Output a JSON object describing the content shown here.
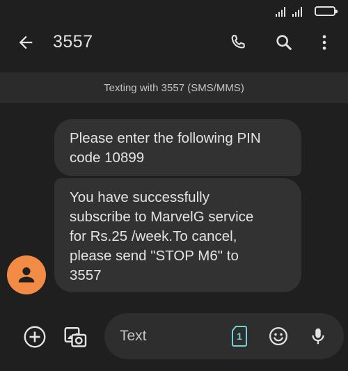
{
  "conversation": {
    "title": "3557",
    "banner": "Texting with 3557 (SMS/MMS)"
  },
  "messages": [
    {
      "text": "Please enter the following PIN\ncode 10899"
    },
    {
      "text": "You have successfully\nsubscribe to MarvelG service\nfor Rs.25 /week.To cancel,\nplease send \"STOP M6\" to\n3557"
    }
  ],
  "composer": {
    "placeholder": "Text",
    "sim_slot": "1"
  },
  "icons": {
    "back": "arrow-back-icon",
    "call": "phone-icon",
    "search": "search-icon",
    "more": "more-vert-icon",
    "add": "add-circle-icon",
    "gallery": "gallery-icon",
    "sim": "sim-card-icon",
    "emoji": "emoji-icon",
    "mic": "mic-icon",
    "avatar": "person-icon"
  },
  "colors": {
    "background": "#1f1f1f",
    "bubble": "#323232",
    "avatar": "#f28b45",
    "sim_accent": "#6fd3d8"
  }
}
